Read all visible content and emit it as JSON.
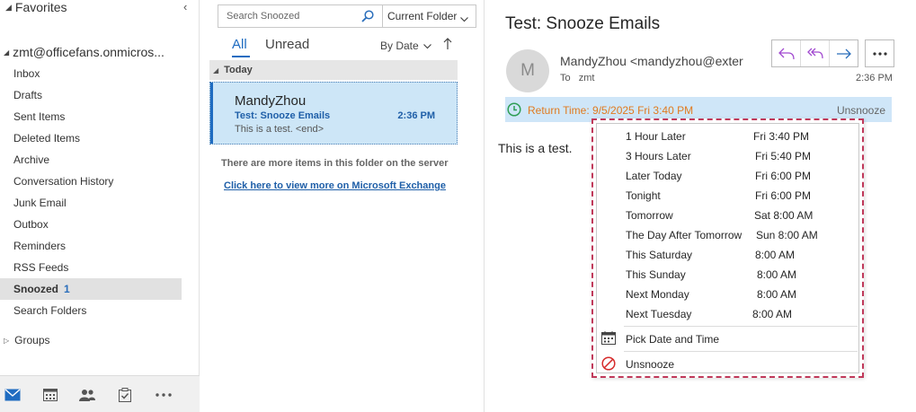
{
  "colors": {
    "accent": "#1f6cc1",
    "selection": "#cde6f7",
    "snooze_orange": "#e07a1f",
    "menu_outline": "#c0395a"
  },
  "folders": {
    "favorites_label": "Favorites",
    "account": "zmt@officefans.onmicros...",
    "items": [
      {
        "label": "Inbox"
      },
      {
        "label": "Drafts"
      },
      {
        "label": "Sent Items"
      },
      {
        "label": "Deleted Items"
      },
      {
        "label": "Archive"
      },
      {
        "label": "Conversation History"
      },
      {
        "label": "Junk Email"
      },
      {
        "label": "Outbox"
      },
      {
        "label": "Reminders"
      },
      {
        "label": "RSS Feeds"
      },
      {
        "label": "Snoozed",
        "count": "1",
        "selected": true
      },
      {
        "label": "Search Folders"
      }
    ],
    "groups_label": "Groups"
  },
  "nav": {
    "icons": [
      "mail-icon",
      "calendar-icon",
      "people-icon",
      "tasks-icon",
      "more-icon"
    ]
  },
  "list": {
    "search_placeholder": "Search Snoozed",
    "scope": "Current Folder",
    "tab_all": "All",
    "tab_unread": "Unread",
    "sort_label": "By Date",
    "group_header": "Today",
    "message": {
      "sender": "MandyZhou",
      "subject": "Test: Snooze Emails",
      "time": "2:36 PM",
      "preview": "This is a test. <end>"
    },
    "more_items_text": "There are more items in this folder on the server",
    "more_items_link": "Click here to view more on Microsoft Exchange"
  },
  "reading": {
    "subject": "Test: Snooze Emails",
    "avatar_initial": "M",
    "from": "MandyZhou <mandyzhou@exter",
    "to_label": "To",
    "to": "zmt",
    "time": "2:36 PM",
    "return_time": "Return Time: 9/5/2025 Fri 3:40 PM",
    "unsnooze_label": "Unsnooze",
    "body": "This is a test."
  },
  "snooze_menu": {
    "options": [
      {
        "label": "1 Hour Later",
        "value": "Fri 3:40 PM"
      },
      {
        "label": "3 Hours Later",
        "value": "Fri 5:40 PM"
      },
      {
        "label": "Later Today",
        "value": "Fri 6:00 PM"
      },
      {
        "label": "Tonight",
        "value": "Fri 6:00 PM"
      },
      {
        "label": "Tomorrow",
        "value": "Sat 8:00 AM"
      },
      {
        "label": "The Day After Tomorrow",
        "value": "Sun 8:00 AM"
      },
      {
        "label": "This Saturday",
        "value": "8:00 AM"
      },
      {
        "label": "This Sunday",
        "value": "8:00 AM"
      },
      {
        "label": "Next Monday",
        "value": "8:00 AM"
      },
      {
        "label": "Next Tuesday",
        "value": "8:00 AM"
      }
    ],
    "pick_date": "Pick Date and Time",
    "unsnooze": "Unsnooze"
  }
}
